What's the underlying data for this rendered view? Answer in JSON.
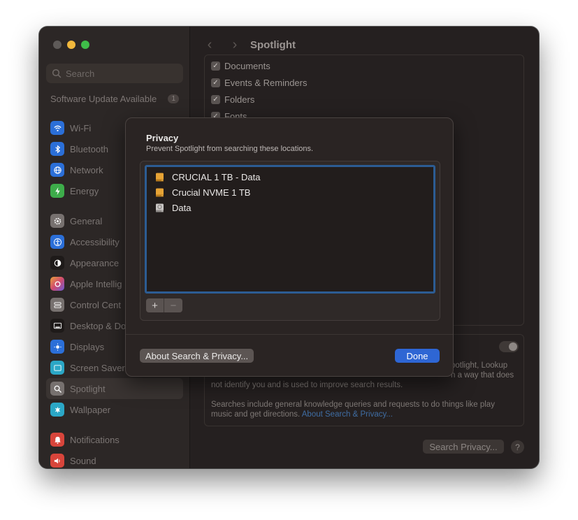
{
  "window": {
    "title": "Spotlight"
  },
  "sidebar": {
    "search_placeholder": "Search",
    "software_update": {
      "label": "Software Update Available",
      "count": "1"
    },
    "items": [
      {
        "label": "Wi-Fi",
        "icon": "wifi-icon",
        "color": "#2b6fd8"
      },
      {
        "label": "Bluetooth",
        "icon": "bluetooth-icon",
        "color": "#2b6fd8"
      },
      {
        "label": "Network",
        "icon": "globe-icon",
        "color": "#2b6fd8"
      },
      {
        "label": "Energy",
        "icon": "bolt-icon",
        "color": "#3dac4a"
      },
      {
        "label": "General",
        "icon": "gear-icon",
        "color": "#77716f"
      },
      {
        "label": "Accessibility",
        "icon": "accessibility-icon",
        "color": "#2b6fd8"
      },
      {
        "label": "Appearance",
        "icon": "appearance-icon",
        "color": "#1e1a19"
      },
      {
        "label": "Apple Intellig",
        "icon": "apple-intelligence-icon",
        "color": "#d66a4a"
      },
      {
        "label": "Control Cent",
        "icon": "control-center-icon",
        "color": "#77716f"
      },
      {
        "label": "Desktop & Do",
        "icon": "desktop-dock-icon",
        "color": "#1e1a19"
      },
      {
        "label": "Displays",
        "icon": "displays-icon",
        "color": "#2b6fd8"
      },
      {
        "label": "Screen Saver",
        "icon": "screen-saver-icon",
        "color": "#2ba7c6"
      },
      {
        "label": "Spotlight",
        "icon": "spotlight-icon",
        "color": "#77716f"
      },
      {
        "label": "Wallpaper",
        "icon": "wallpaper-icon",
        "color": "#2ba7c6"
      },
      {
        "label": "Notifications",
        "icon": "notifications-icon",
        "color": "#d8453b"
      },
      {
        "label": "Sound",
        "icon": "sound-icon",
        "color": "#d8453b"
      }
    ]
  },
  "main": {
    "categories": [
      {
        "label": "Documents",
        "checked": true
      },
      {
        "label": "Events & Reminders",
        "checked": true
      },
      {
        "label": "Folders",
        "checked": true
      },
      {
        "label": "Fonts",
        "checked": true
      }
    ],
    "help_text_1a": "potlight, Lookup",
    "help_text_1b": "n a way that does",
    "help_text_2": "not identify you and is used to improve search results.",
    "help_text_3a": "Searches include general knowledge queries and requests to do things like play",
    "help_text_3b": "music and get directions.",
    "help_link": "About Search & Privacy...",
    "search_privacy_button": "Search Privacy...",
    "help_button": "?"
  },
  "sheet": {
    "title": "Privacy",
    "subtitle": "Prevent Spotlight from searching these locations.",
    "locations": [
      {
        "label": "CRUCIAL 1 TB - Data",
        "icon": "external-drive-icon"
      },
      {
        "label": "Crucial NVME 1 TB",
        "icon": "external-drive-icon"
      },
      {
        "label": "Data",
        "icon": "internal-drive-icon"
      }
    ],
    "add_button": "+",
    "remove_button": "−",
    "about_button": "About Search & Privacy...",
    "done_button": "Done"
  }
}
